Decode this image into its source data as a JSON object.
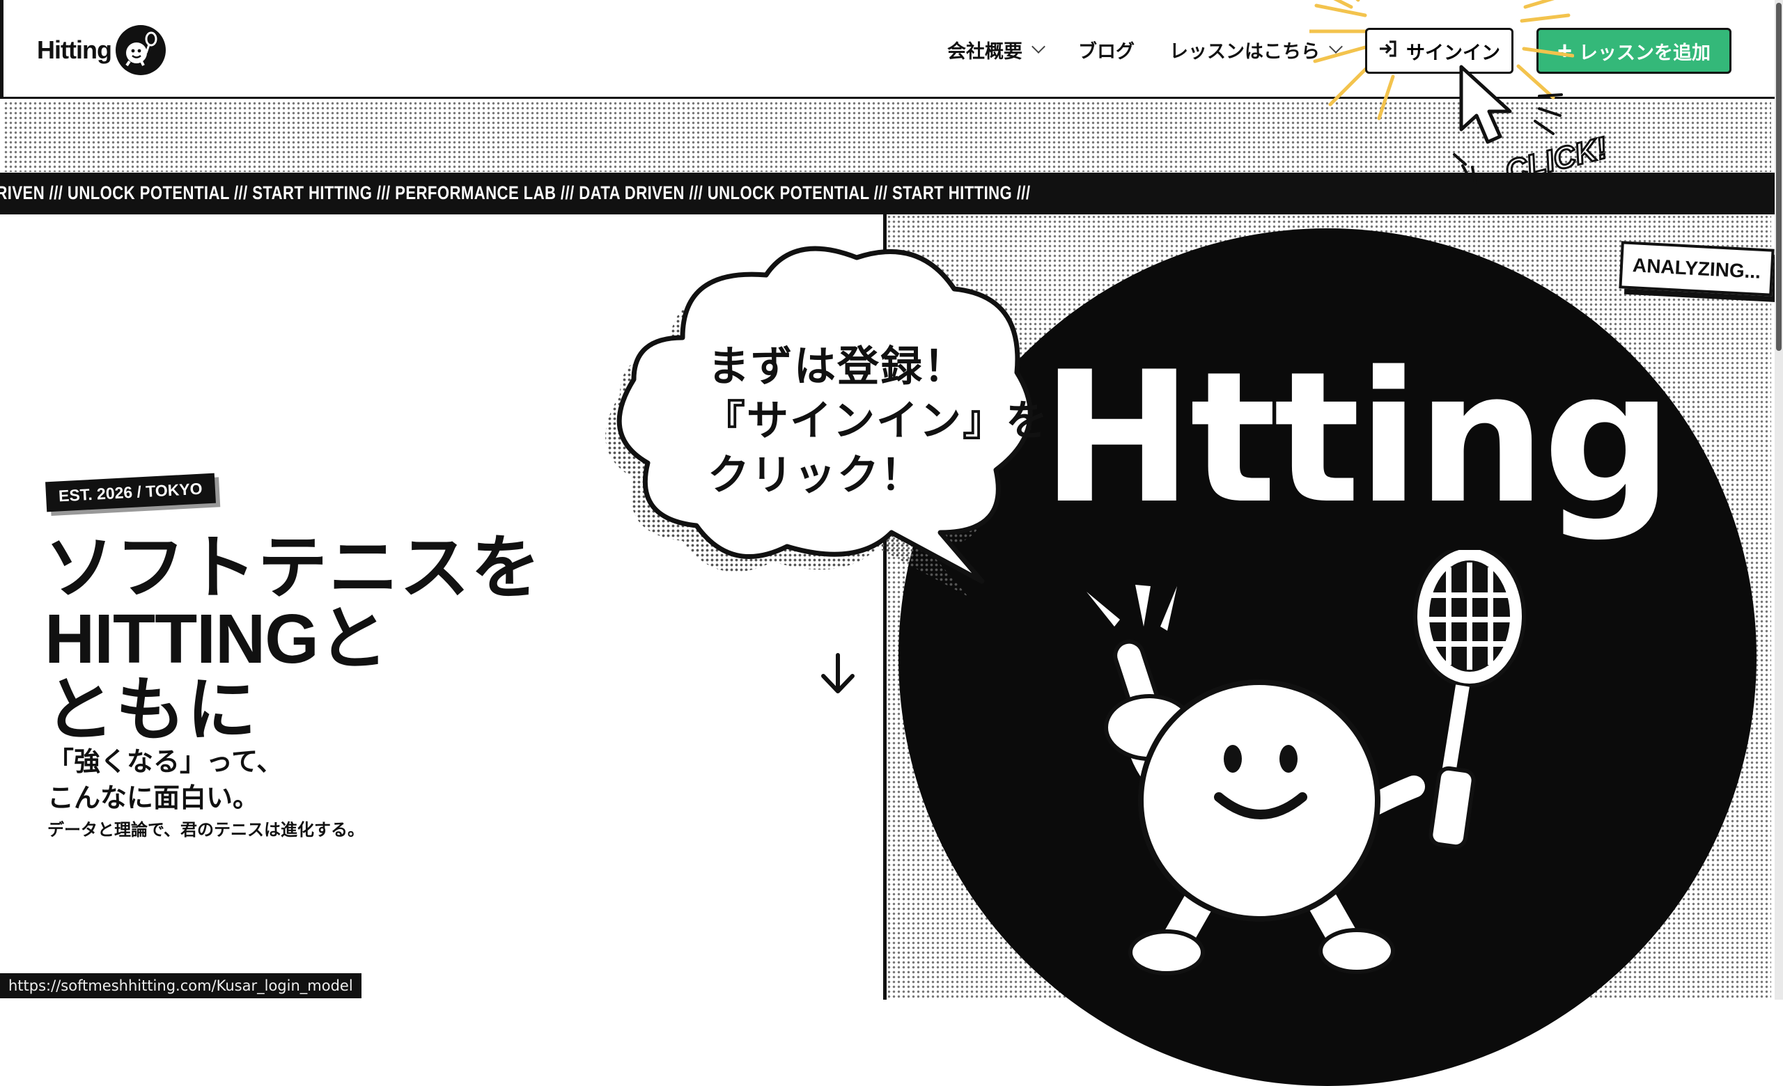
{
  "header": {
    "logo_text": "Hitting",
    "nav": [
      {
        "label": "会社概要"
      },
      {
        "label": "ブログ"
      },
      {
        "label": "レッスンはこちら"
      }
    ],
    "signin_label": "サインイン",
    "add_lesson_label": "レッスンを追加",
    "add_lesson_color": "#34b879"
  },
  "ticker": {
    "text": "DRIVEN /// UNLOCK POTENTIAL /// START HITTING /// PERFORMANCE LAB /// DATA DRIVEN /// UNLOCK POTENTIAL /// START HITTING ///"
  },
  "hero": {
    "badge": "EST. 2026 / TOKYO",
    "title_line1": "ソフトテニスを",
    "title_line2": "HITTINGと",
    "title_line3": "ともに",
    "sub_line1": "「強くなる」って、",
    "sub_line2": "こんなに面白い。",
    "desc": "データと理論で、君のテニスは進化する。"
  },
  "bubble": {
    "line1": "まずは登録！",
    "line2": "『サインイン』を",
    "line3": "クリック！"
  },
  "visual": {
    "big_word": "Htting",
    "analyzing": "ANALYZING...",
    "click_label": "CLICK!"
  },
  "status_bar": {
    "url": "https://softmeshhitting.com/Kusar_login_model"
  }
}
